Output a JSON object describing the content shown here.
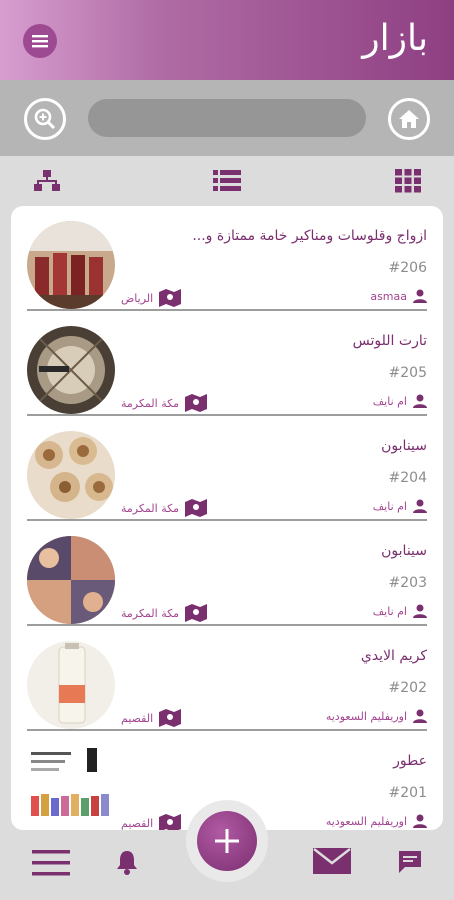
{
  "header": {
    "logo_text": "بازار"
  },
  "search": {
    "placeholder": ""
  },
  "listings": [
    {
      "title": "ازواج وقلوسات ومناكير خامة ممتازة و...",
      "number": "#206",
      "user": "asmaa",
      "city": "الرياض"
    },
    {
      "title": "تارت اللوتس",
      "number": "#205",
      "user": "ام نايف",
      "city": "مكة المكرمة"
    },
    {
      "title": "سينابون",
      "number": "#204",
      "user": "ام نايف",
      "city": "مكة المكرمة"
    },
    {
      "title": "سينابون",
      "number": "#203",
      "user": "ام نايف",
      "city": "مكة المكرمة"
    },
    {
      "title": "كريم الايدي",
      "number": "#202",
      "user": "اوريفليم السعوديه",
      "city": "القصيم"
    },
    {
      "title": "عطور",
      "number": "#201",
      "user": "اوريفليم السعوديه",
      "city": "القصيم"
    }
  ],
  "colors": {
    "brand": "#8e3f82",
    "accent": "#a34590",
    "header_light": "#d79ed0"
  },
  "icons": [
    "menu-icon",
    "zoom-search-icon",
    "home-icon",
    "sitemap-icon",
    "list-view-icon",
    "grid-view-icon",
    "user-icon",
    "map-marker-icon",
    "hamburger-icon",
    "bell-icon",
    "plus-icon",
    "envelope-icon",
    "chat-icon"
  ]
}
